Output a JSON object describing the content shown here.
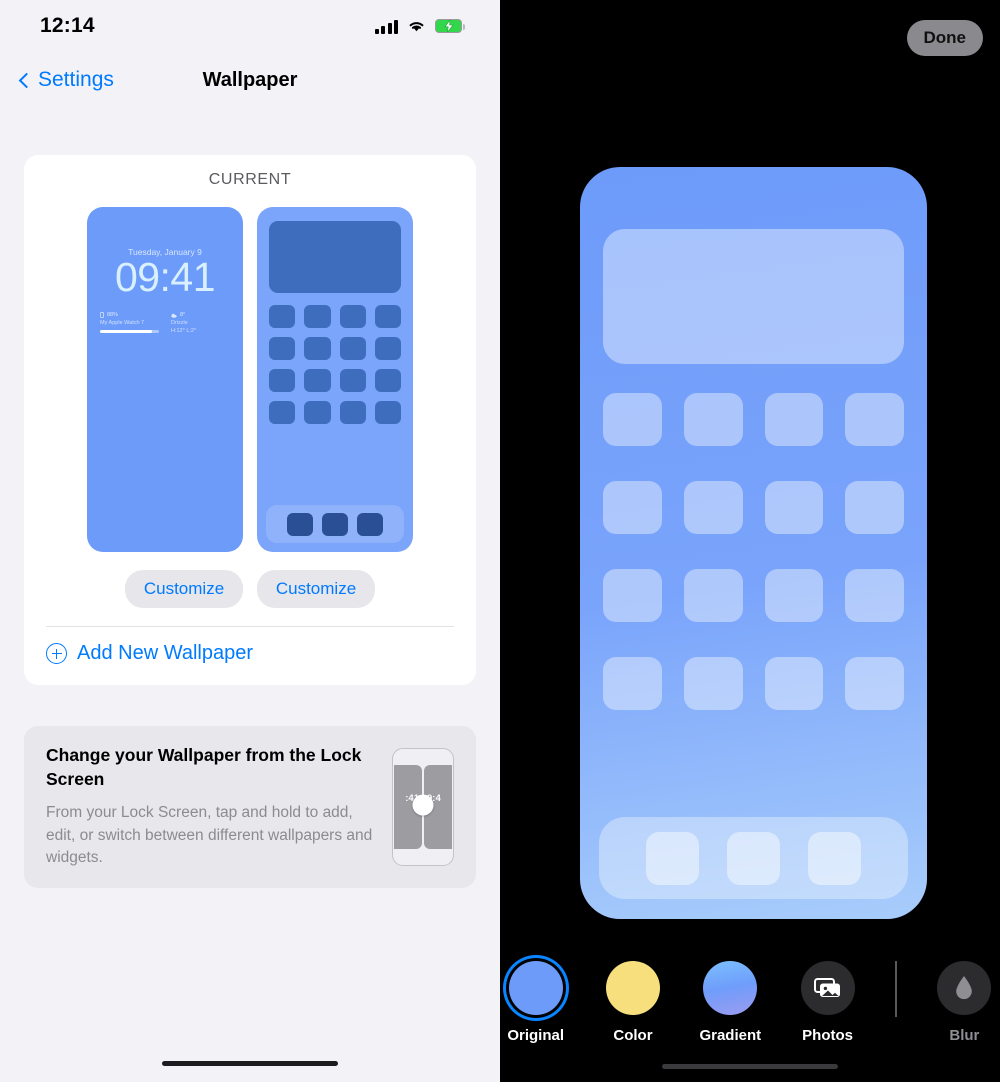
{
  "left": {
    "status_bar": {
      "time": "12:14",
      "signal_icon": "cellular-bars-icon",
      "wifi_icon": "wifi-icon",
      "battery_icon": "battery-charging-icon"
    },
    "nav": {
      "back_label": "Settings",
      "back_icon": "chevron-left-icon",
      "title": "Wallpaper"
    },
    "current_section": {
      "label": "CURRENT",
      "lock_preview": {
        "date": "Tuesday, January 9",
        "time": "09:41",
        "battery_widget": {
          "value": "88%",
          "device": "My Apple Watch 7"
        },
        "weather_widget": {
          "temp": "8°",
          "condition": "Drizzle",
          "range": "H:12° L:2°"
        }
      },
      "home_preview": {
        "name": "home-screen-preview"
      },
      "customize_lock_label": "Customize",
      "customize_home_label": "Customize",
      "add_new_label": "Add New Wallpaper",
      "add_new_icon": "plus-circle-icon"
    },
    "info_card": {
      "title": "Change your Wallpaper from the Lock Screen",
      "body": "From your Lock Screen, tap and hold to add, edit, or switch between different wallpapers and widgets.",
      "illustration": {
        "left_time": ":41",
        "right_time": "9:4",
        "touch_indicator": "touch-dot"
      }
    }
  },
  "right": {
    "done_label": "Done",
    "preview": {
      "name": "wallpaper-preview"
    },
    "toolbar": [
      {
        "label": "Original",
        "icon": "original-swatch",
        "selected": true,
        "dim": false
      },
      {
        "label": "Color",
        "icon": "color-swatch",
        "selected": false,
        "dim": false
      },
      {
        "label": "Gradient",
        "icon": "gradient-swatch",
        "selected": false,
        "dim": false
      },
      {
        "label": "Photos",
        "icon": "photos-icon",
        "selected": false,
        "dim": false
      },
      {
        "label": "Blur",
        "icon": "blur-droplet-icon",
        "selected": false,
        "dim": true
      }
    ]
  },
  "colors": {
    "accent_blue": "#007aff",
    "selection_blue": "#0a84ff",
    "wallpaper_blue": "#6d9bfa",
    "color_swatch_yellow": "#f6df7c",
    "battery_green": "#32d74b",
    "panel_bg": "#f2f2f7",
    "card_bg": "#ffffff",
    "info_card_bg": "#e7e7ec"
  }
}
